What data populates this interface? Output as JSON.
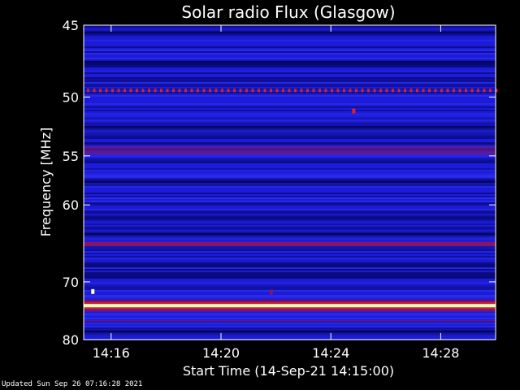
{
  "chart_data": {
    "type": "heatmap",
    "title": "Solar radio Flux (Glasgow)",
    "xlabel": "Start Time (14-Sep-21 14:15:00)",
    "ylabel": "Frequency [MHz]",
    "x_range": [
      "14:15:00",
      "14:30:00"
    ],
    "y_range_mhz": [
      45,
      80
    ],
    "y_ticks": [
      45,
      50,
      55,
      60,
      70,
      80
    ],
    "x_ticks": [
      "14:16",
      "14:20",
      "14:24",
      "14:28"
    ],
    "x_tick_minutes": [
      1,
      5,
      9,
      13
    ],
    "y_axis_scale": "reciprocal",
    "colormap": {
      "low": "#000046",
      "background": "#1c1cd8",
      "mid": "#8a1463",
      "high": "#e02020",
      "peak": "#ffffc0"
    },
    "bands": [
      {
        "freq_mhz": 49.5,
        "intensity": "medium-dotted"
      },
      {
        "freq_mhz": 54.5,
        "intensity": "low-medium"
      },
      {
        "freq_mhz": 64.7,
        "intensity": "medium"
      },
      {
        "freq_mhz": 73.8,
        "intensity": "peak"
      },
      {
        "freq_mhz": 76.5,
        "intensity": "low"
      }
    ],
    "dark_bands_mhz": [
      45.5,
      47.5,
      52.5,
      57.5,
      61.5,
      63.5,
      67.5,
      69.0,
      78.5
    ],
    "spots": [
      {
        "time": "14:15:20",
        "freq_mhz": 71.5,
        "intensity": "peak"
      },
      {
        "time": "14:24:50",
        "freq_mhz": 51.1,
        "intensity": "high"
      },
      {
        "time": "14:21:50",
        "freq_mhz": 71.6,
        "intensity": "medium"
      }
    ]
  },
  "footer": "Updated Sun Sep 26 07:16:28 2021"
}
